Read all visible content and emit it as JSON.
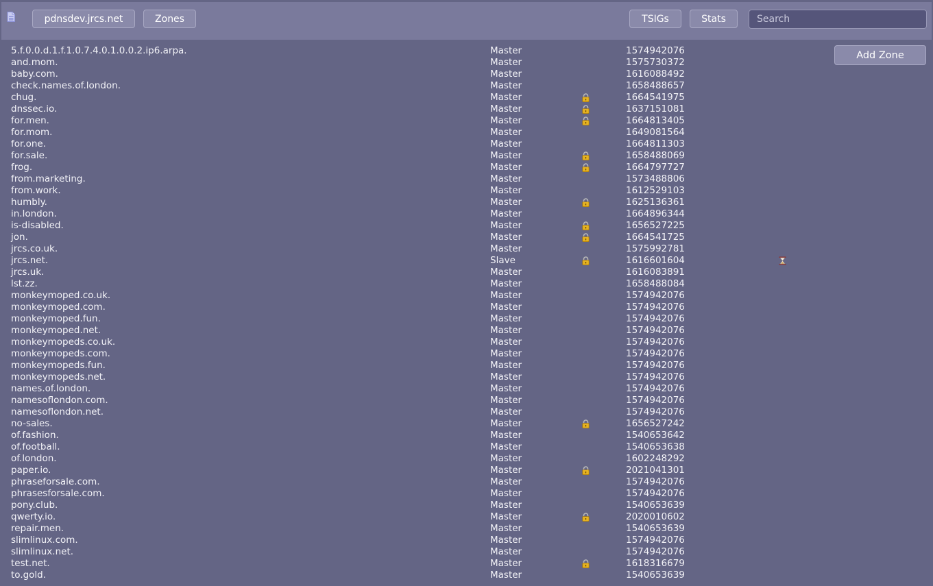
{
  "header": {
    "server_label": "pdnsdev.jrcs.net",
    "zones_label": "Zones",
    "tsigs_label": "TSIGs",
    "stats_label": "Stats",
    "search_placeholder": "Search",
    "search_value": ""
  },
  "actions": {
    "add_zone_label": "Add Zone"
  },
  "icons": {
    "doc": "document-icon",
    "lock": "lock-icon",
    "pending": "hourglass-icon"
  },
  "zones": [
    {
      "name": "5.f.0.0.d.1.f.1.0.7.4.0.1.0.0.2.ip6.arpa.",
      "kind": "Master",
      "dnssec": false,
      "serial": "1574942076",
      "pending": false
    },
    {
      "name": "and.mom.",
      "kind": "Master",
      "dnssec": false,
      "serial": "1575730372",
      "pending": false
    },
    {
      "name": "baby.com.",
      "kind": "Master",
      "dnssec": false,
      "serial": "1616088492",
      "pending": false
    },
    {
      "name": "check.names.of.london.",
      "kind": "Master",
      "dnssec": false,
      "serial": "1658488657",
      "pending": false
    },
    {
      "name": "chug.",
      "kind": "Master",
      "dnssec": true,
      "serial": "1664541975",
      "pending": false
    },
    {
      "name": "dnssec.io.",
      "kind": "Master",
      "dnssec": true,
      "serial": "1637151081",
      "pending": false
    },
    {
      "name": "for.men.",
      "kind": "Master",
      "dnssec": true,
      "serial": "1664813405",
      "pending": false
    },
    {
      "name": "for.mom.",
      "kind": "Master",
      "dnssec": false,
      "serial": "1649081564",
      "pending": false
    },
    {
      "name": "for.one.",
      "kind": "Master",
      "dnssec": false,
      "serial": "1664811303",
      "pending": false
    },
    {
      "name": "for.sale.",
      "kind": "Master",
      "dnssec": true,
      "serial": "1658488069",
      "pending": false
    },
    {
      "name": "frog.",
      "kind": "Master",
      "dnssec": true,
      "serial": "1664797727",
      "pending": false
    },
    {
      "name": "from.marketing.",
      "kind": "Master",
      "dnssec": false,
      "serial": "1573488806",
      "pending": false
    },
    {
      "name": "from.work.",
      "kind": "Master",
      "dnssec": false,
      "serial": "1612529103",
      "pending": false
    },
    {
      "name": "humbly.",
      "kind": "Master",
      "dnssec": true,
      "serial": "1625136361",
      "pending": false
    },
    {
      "name": "in.london.",
      "kind": "Master",
      "dnssec": false,
      "serial": "1664896344",
      "pending": false
    },
    {
      "name": "is-disabled.",
      "kind": "Master",
      "dnssec": true,
      "serial": "1656527225",
      "pending": false
    },
    {
      "name": "jon.",
      "kind": "Master",
      "dnssec": true,
      "serial": "1664541725",
      "pending": false
    },
    {
      "name": "jrcs.co.uk.",
      "kind": "Master",
      "dnssec": false,
      "serial": "1575992781",
      "pending": false
    },
    {
      "name": "jrcs.net.",
      "kind": "Slave",
      "dnssec": true,
      "serial": "1616601604",
      "pending": true
    },
    {
      "name": "jrcs.uk.",
      "kind": "Master",
      "dnssec": false,
      "serial": "1616083891",
      "pending": false
    },
    {
      "name": "lst.zz.",
      "kind": "Master",
      "dnssec": false,
      "serial": "1658488084",
      "pending": false
    },
    {
      "name": "monkeymoped.co.uk.",
      "kind": "Master",
      "dnssec": false,
      "serial": "1574942076",
      "pending": false
    },
    {
      "name": "monkeymoped.com.",
      "kind": "Master",
      "dnssec": false,
      "serial": "1574942076",
      "pending": false
    },
    {
      "name": "monkeymoped.fun.",
      "kind": "Master",
      "dnssec": false,
      "serial": "1574942076",
      "pending": false
    },
    {
      "name": "monkeymoped.net.",
      "kind": "Master",
      "dnssec": false,
      "serial": "1574942076",
      "pending": false
    },
    {
      "name": "monkeymopeds.co.uk.",
      "kind": "Master",
      "dnssec": false,
      "serial": "1574942076",
      "pending": false
    },
    {
      "name": "monkeymopeds.com.",
      "kind": "Master",
      "dnssec": false,
      "serial": "1574942076",
      "pending": false
    },
    {
      "name": "monkeymopeds.fun.",
      "kind": "Master",
      "dnssec": false,
      "serial": "1574942076",
      "pending": false
    },
    {
      "name": "monkeymopeds.net.",
      "kind": "Master",
      "dnssec": false,
      "serial": "1574942076",
      "pending": false
    },
    {
      "name": "names.of.london.",
      "kind": "Master",
      "dnssec": false,
      "serial": "1574942076",
      "pending": false
    },
    {
      "name": "namesoflondon.com.",
      "kind": "Master",
      "dnssec": false,
      "serial": "1574942076",
      "pending": false
    },
    {
      "name": "namesoflondon.net.",
      "kind": "Master",
      "dnssec": false,
      "serial": "1574942076",
      "pending": false
    },
    {
      "name": "no-sales.",
      "kind": "Master",
      "dnssec": true,
      "serial": "1656527242",
      "pending": false
    },
    {
      "name": "of.fashion.",
      "kind": "Master",
      "dnssec": false,
      "serial": "1540653642",
      "pending": false
    },
    {
      "name": "of.football.",
      "kind": "Master",
      "dnssec": false,
      "serial": "1540653638",
      "pending": false
    },
    {
      "name": "of.london.",
      "kind": "Master",
      "dnssec": false,
      "serial": "1602248292",
      "pending": false
    },
    {
      "name": "paper.io.",
      "kind": "Master",
      "dnssec": true,
      "serial": "2021041301",
      "pending": false
    },
    {
      "name": "phraseforsale.com.",
      "kind": "Master",
      "dnssec": false,
      "serial": "1574942076",
      "pending": false
    },
    {
      "name": "phrasesforsale.com.",
      "kind": "Master",
      "dnssec": false,
      "serial": "1574942076",
      "pending": false
    },
    {
      "name": "pony.club.",
      "kind": "Master",
      "dnssec": false,
      "serial": "1540653639",
      "pending": false
    },
    {
      "name": "qwerty.io.",
      "kind": "Master",
      "dnssec": true,
      "serial": "2020010602",
      "pending": false
    },
    {
      "name": "repair.men.",
      "kind": "Master",
      "dnssec": false,
      "serial": "1540653639",
      "pending": false
    },
    {
      "name": "slimlinux.com.",
      "kind": "Master",
      "dnssec": false,
      "serial": "1574942076",
      "pending": false
    },
    {
      "name": "slimlinux.net.",
      "kind": "Master",
      "dnssec": false,
      "serial": "1574942076",
      "pending": false
    },
    {
      "name": "test.net.",
      "kind": "Master",
      "dnssec": true,
      "serial": "1618316679",
      "pending": false
    },
    {
      "name": "to.gold.",
      "kind": "Master",
      "dnssec": false,
      "serial": "1540653639",
      "pending": false
    }
  ]
}
